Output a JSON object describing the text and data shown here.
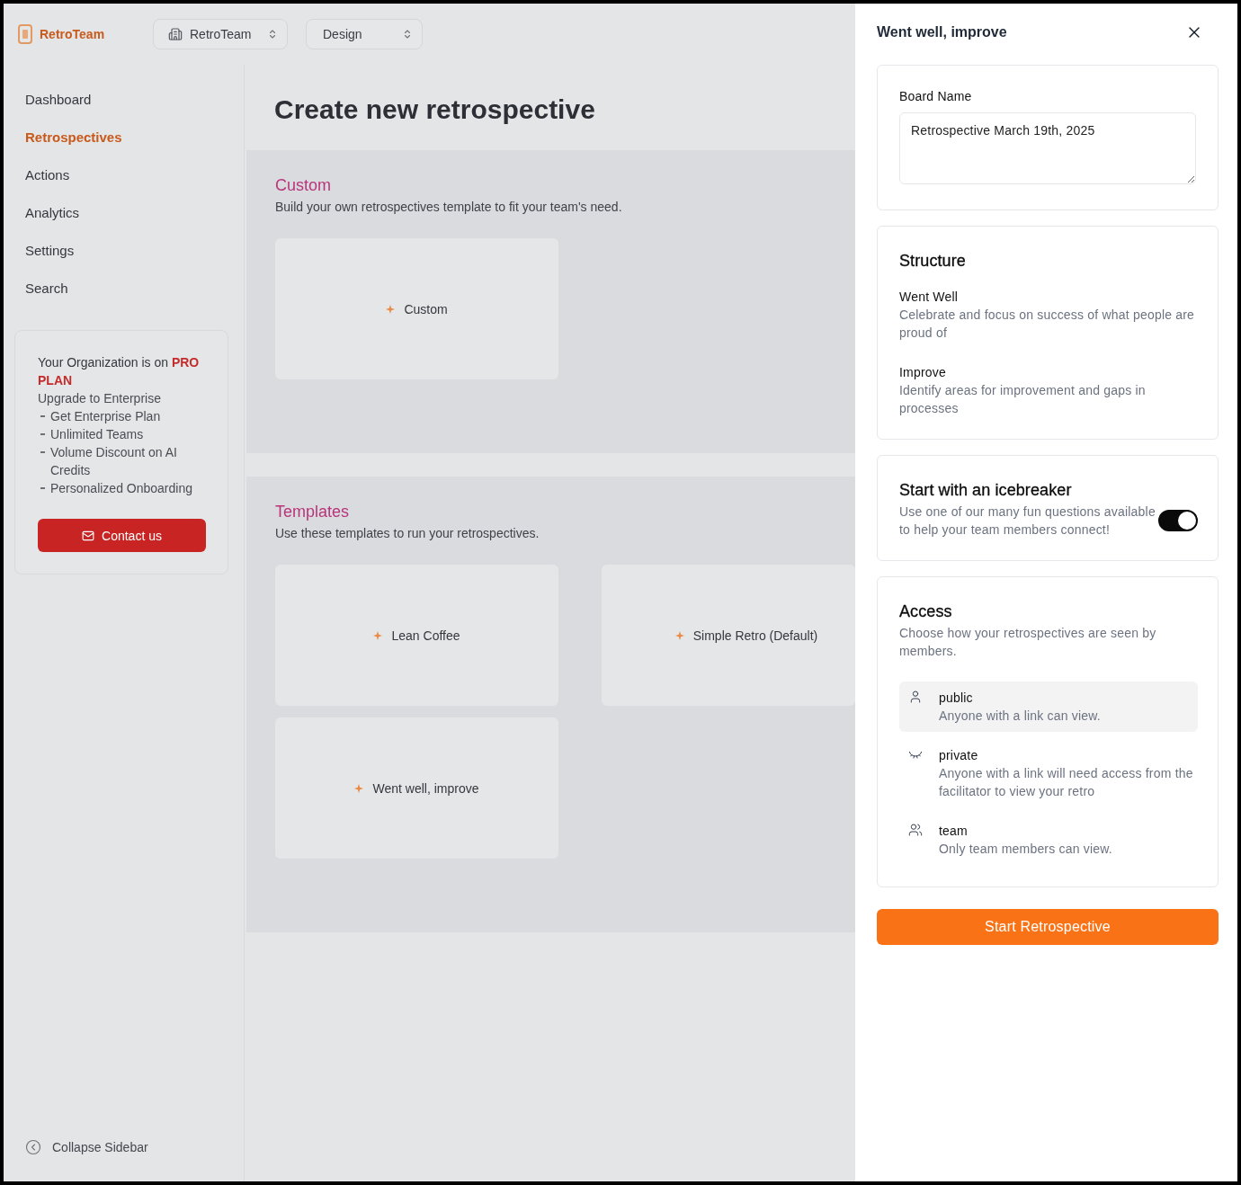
{
  "header": {
    "logo": "RetroTeam",
    "breadcrumbs": [
      {
        "label": "RetroTeam"
      },
      {
        "label": "Design"
      }
    ]
  },
  "sidebar": {
    "items": [
      {
        "label": "Dashboard",
        "selected": false
      },
      {
        "label": "Retrospectives",
        "selected": true
      },
      {
        "label": "Actions",
        "selected": false
      },
      {
        "label": "Analytics",
        "selected": false
      },
      {
        "label": "Settings",
        "selected": false
      },
      {
        "label": "Search",
        "selected": false
      }
    ],
    "upgrade_card": {
      "plan": "Your Organization is on **PRO PLAN**",
      "subtitle": "Upgrade to Enterprise",
      "features": [
        "Get Enterprise Plan",
        "Unlimited Teams",
        "Volume Discount on AI Credits",
        "Personalized Onboarding"
      ],
      "button": "Contact us"
    },
    "collapse": "Collapse Sidebar"
  },
  "main": {
    "title": "Create new retrospective",
    "sections": [
      {
        "title": "Custom",
        "description": "Build your own retrospectives template to fit your team's need.",
        "cards": [
          "Custom"
        ]
      },
      {
        "title": "Templates",
        "description": "Use these templates to run your retrospectives.",
        "cards": [
          "Lean Coffee",
          "Simple Retro (Default)",
          "Went well, improve"
        ]
      }
    ]
  },
  "drawer": {
    "title": "Went well, improve",
    "board_name": {
      "label": "Board Name",
      "value": "Retrospective March 19th, 2025"
    },
    "structure": {
      "title": "Structure",
      "columns": [
        {
          "name": "Went Well",
          "description": "Celebrate and focus on success of what people are proud of"
        },
        {
          "name": "Improve",
          "description": "Identify areas for improvement and gaps in processes"
        }
      ]
    },
    "icebreaker": {
      "title": "Start with an icebreaker",
      "description": "Use one of our many fun questions available to help your team members connect!",
      "on": true
    },
    "access": {
      "title": "Access",
      "description": "Choose how your retrospectives are seen by members.",
      "options": [
        {
          "name": "public",
          "description": "Anyone with a link can view.",
          "selected": true
        },
        {
          "name": "private",
          "description": "Anyone with a link will need access from the facilitator to view your retro",
          "selected": false
        },
        {
          "name": "team",
          "description": "Only team members can view.",
          "selected": false
        }
      ]
    },
    "submit": "Start Retrospective"
  }
}
